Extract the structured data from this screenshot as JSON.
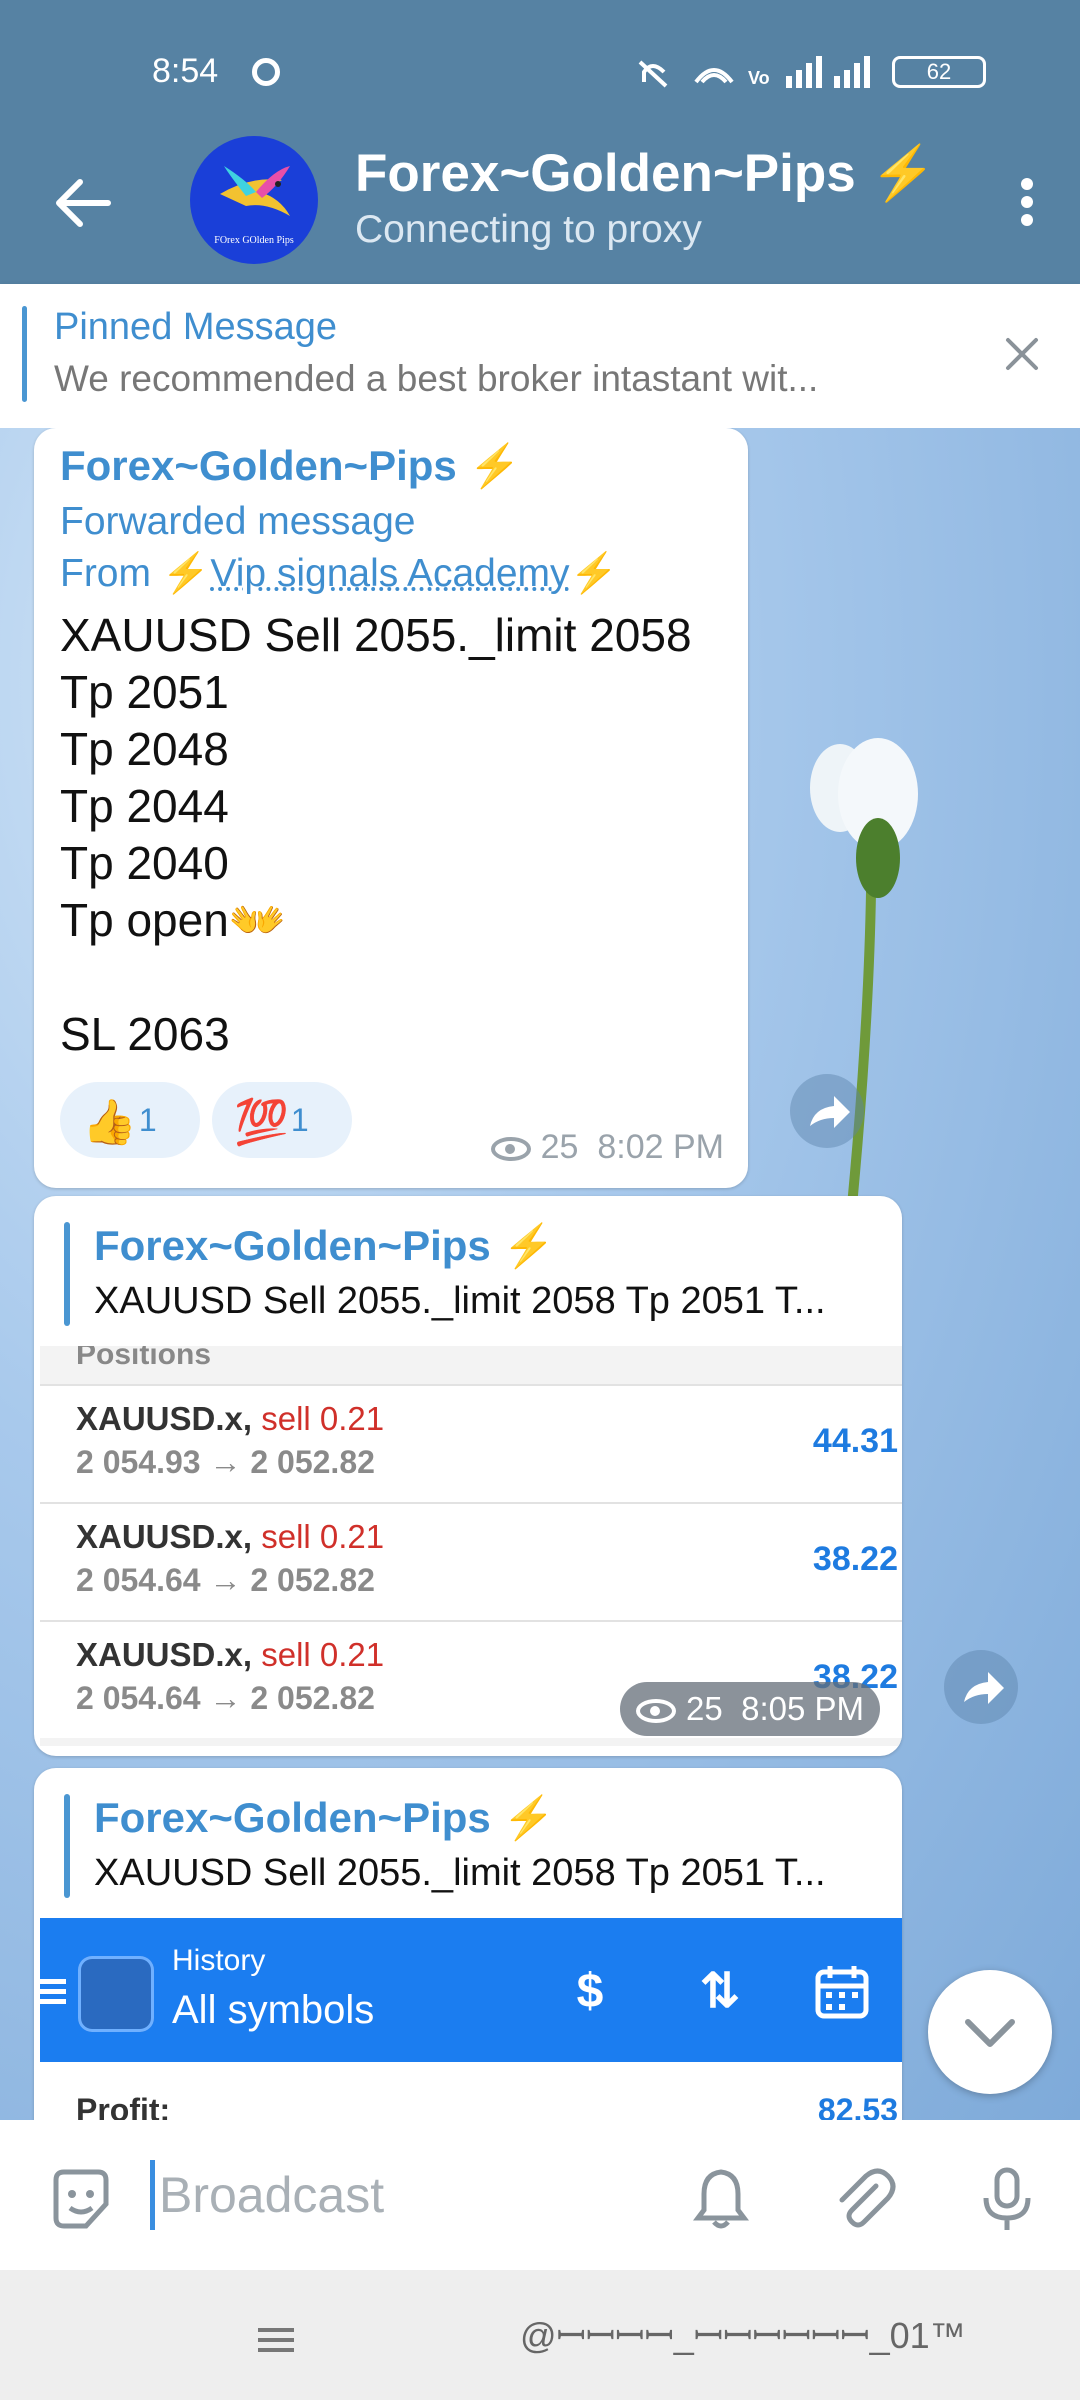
{
  "status_bar": {
    "time": "8:54",
    "battery": "62"
  },
  "header": {
    "title": "Forex~Golden~Pips ⚡",
    "subtitle": "Connecting to proxy",
    "avatar_text": "FOrex GOlden Pips"
  },
  "pinned": {
    "title": "Pinned Message",
    "text": "We recommended a best broker  intastant wit..."
  },
  "messages": [
    {
      "author": "Forex~Golden~Pips ⚡",
      "forwarded_label": "Forwarded message",
      "from_prefix": "From ⚡",
      "from_link": "Vip signals Academy",
      "from_suffix": "⚡",
      "lines": [
        "XAUUSD Sell 2055._limit 2058",
        "Tp 2051",
        "Tp 2048",
        "Tp 2044",
        "Tp 2040",
        "Tp open👐",
        "",
        "SL 2063"
      ],
      "reactions": [
        {
          "emoji": "👍",
          "count": "1"
        },
        {
          "emoji": "💯",
          "count": "1"
        }
      ],
      "views": "25",
      "time": "8:02 PM"
    },
    {
      "quote_author": "Forex~Golden~Pips ⚡",
      "quote_text": "XAUUSD Sell 2055._limit 2058 Tp 2051 T...",
      "positions_header": "Positions",
      "positions": [
        {
          "symbol": "XAUUSD.x,",
          "side": "sell 0.21",
          "prices": "2 054.93 → 2 052.82",
          "profit": "44.31"
        },
        {
          "symbol": "XAUUSD.x,",
          "side": "sell 0.21",
          "prices": "2 054.64 → 2 052.82",
          "profit": "38.22"
        },
        {
          "symbol": "XAUUSD.x,",
          "side": "sell 0.21",
          "prices": "2 054.64 → 2 052.82",
          "profit": "38.22"
        }
      ],
      "views": "25",
      "time": "8:05 PM"
    },
    {
      "quote_author": "Forex~Golden~Pips ⚡",
      "quote_text": "XAUUSD Sell 2055._limit 2058 Tp 2051 T...",
      "history_label": "History",
      "history_value": "All symbols",
      "profit_label": "Profit:",
      "profit_value": "82.53"
    }
  ],
  "composer": {
    "placeholder": "Broadcast"
  },
  "watermark": "@ꟷꟷꟷꟷ_ꟷꟷꟷꟷꟷꟷ_01™"
}
